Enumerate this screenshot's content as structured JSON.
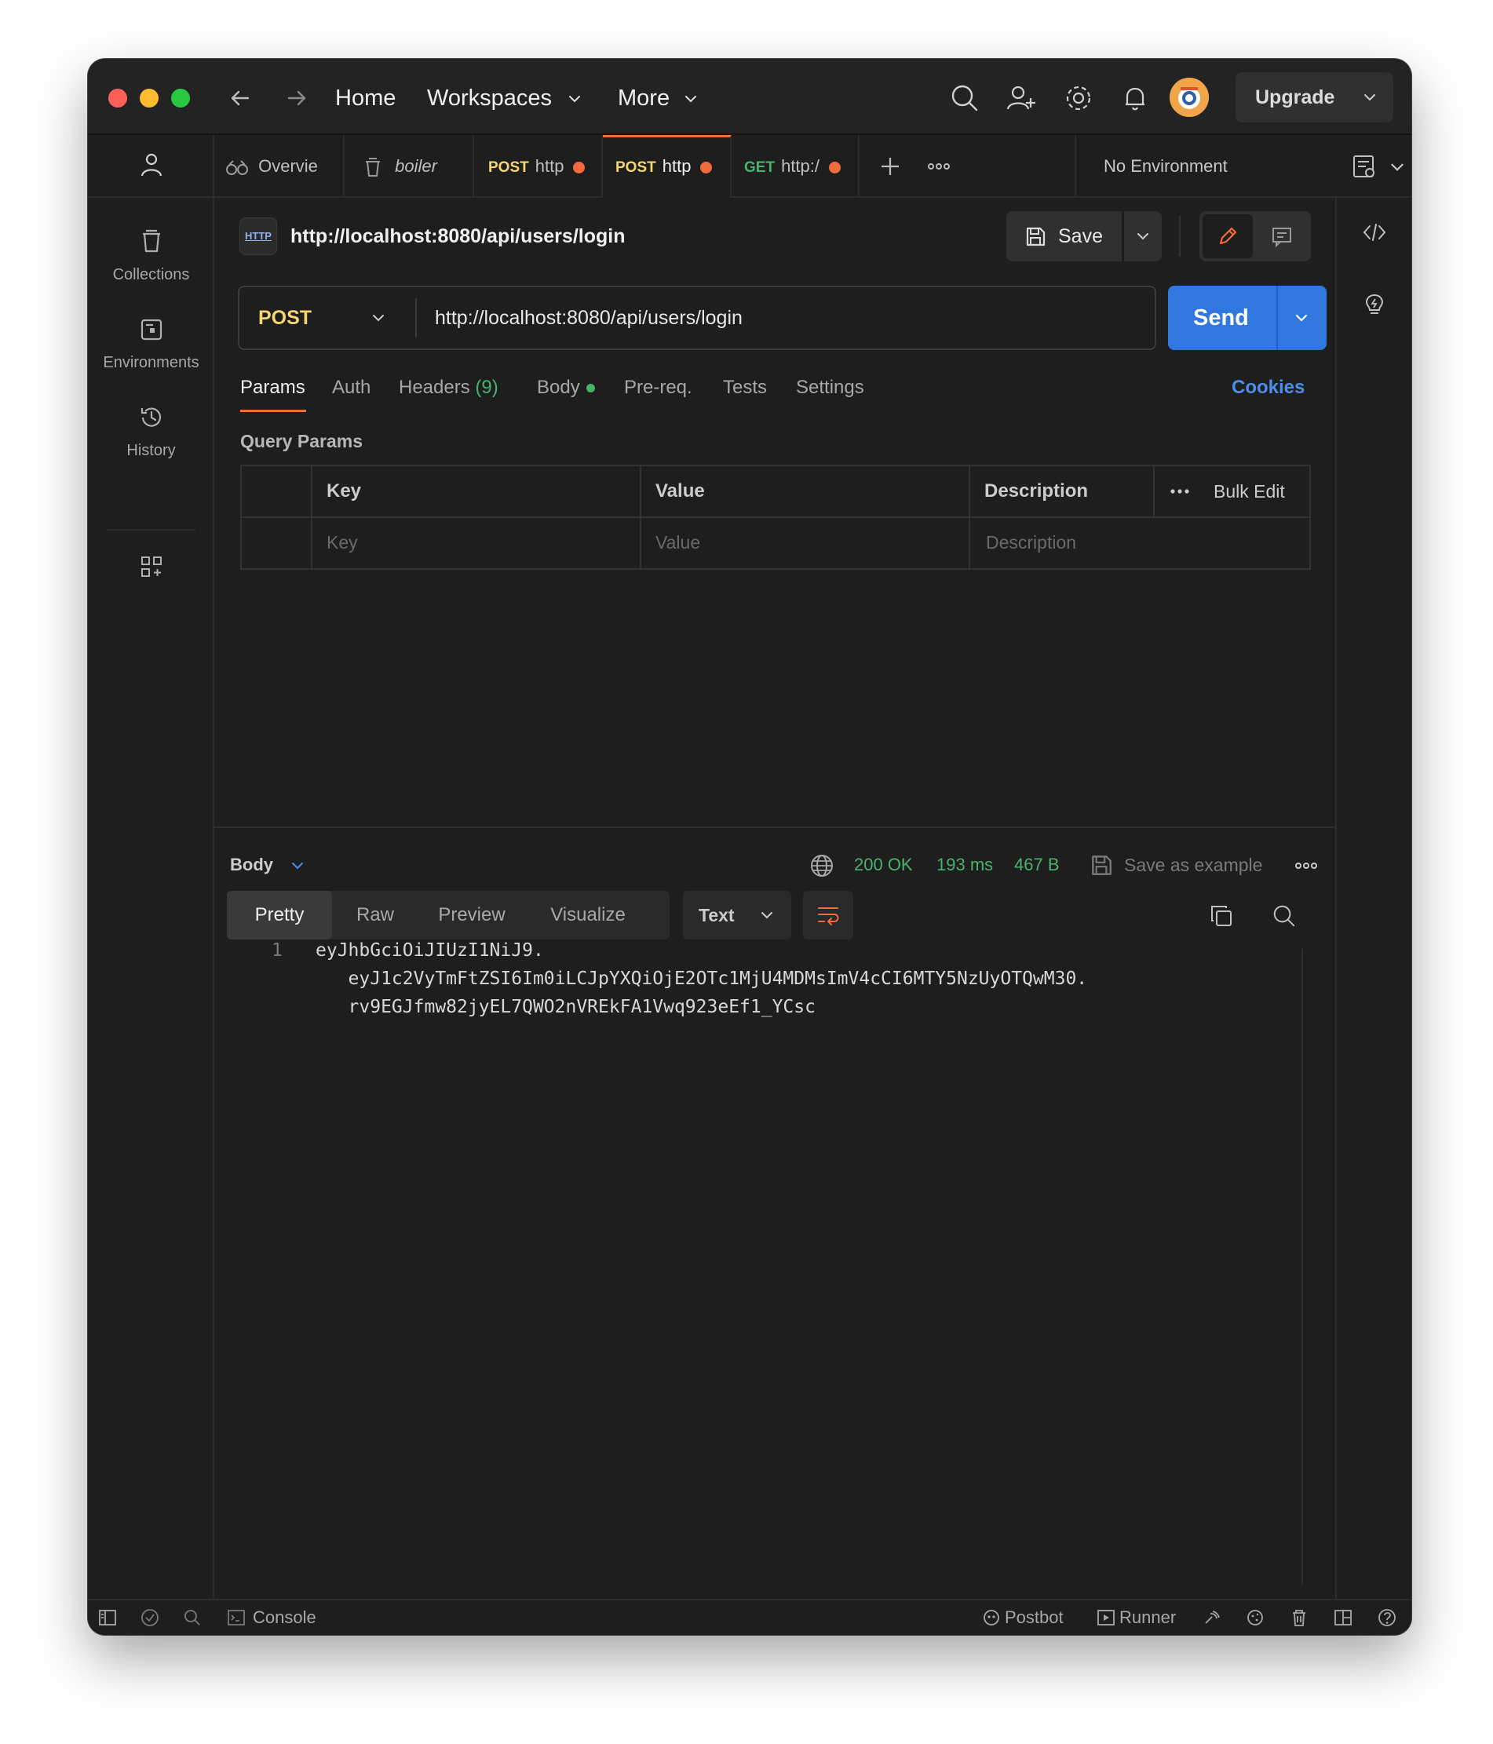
{
  "titlebar": {
    "nav": [
      "Home",
      "Workspaces",
      "More"
    ],
    "upgrade_label": "Upgrade"
  },
  "sidebar": {
    "items": [
      {
        "label": "Collections",
        "icon": "collections-icon"
      },
      {
        "label": "Environments",
        "icon": "environments-icon"
      },
      {
        "label": "History",
        "icon": "history-icon"
      }
    ]
  },
  "tabs": [
    {
      "label": "Overvie",
      "icon": "overview-icon"
    },
    {
      "label": "boiler",
      "icon": "collection-icon"
    },
    {
      "method": "POST",
      "label": "http",
      "unsaved": true
    },
    {
      "method": "POST",
      "label": "http",
      "unsaved": true,
      "active": true
    },
    {
      "method": "GET",
      "label": "http:/",
      "unsaved": true
    }
  ],
  "environment": "No Environment",
  "request": {
    "title": "http://localhost:8080/api/users/login",
    "save_label": "Save",
    "http_badge": "HTTP",
    "method": "POST",
    "url": "http://localhost:8080/api/users/login",
    "send_label": "Send",
    "subtabs": {
      "params": "Params",
      "auth": "Auth",
      "headers": "Headers",
      "headers_count": "(9)",
      "body": "Body",
      "prereq": "Pre-req.",
      "tests": "Tests",
      "settings": "Settings"
    },
    "cookies": "Cookies",
    "query_params_title": "Query Params",
    "table": {
      "headers": [
        "Key",
        "Value",
        "Description"
      ],
      "bulk_edit": "Bulk Edit",
      "placeholders": [
        "Key",
        "Value",
        "Description"
      ]
    }
  },
  "response": {
    "body_label": "Body",
    "status": "200 OK",
    "time": "193 ms",
    "size": "467 B",
    "save_example": "Save as example",
    "views": [
      "Pretty",
      "Raw",
      "Preview",
      "Visualize"
    ],
    "format": "Text",
    "line_number": "1",
    "code_lines": [
      "eyJhbGciOiJIUzI1NiJ9.",
      "   eyJ1c2VyTmFtZSI6Im0iLCJpYXQiOjE2OTc1MjU4MDMsImV4cCI6MTY5NzUyOTQwM30.",
      "   rv9EGJfmw82jyEL7QWO2nVREkFA1Vwq923eEf1_YCsc"
    ]
  },
  "statusbar": {
    "console": "Console",
    "postbot": "Postbot",
    "runner": "Runner"
  },
  "colors": {
    "accent": "#f26b3a",
    "send": "#3077e0",
    "success": "#49b36b",
    "method_post": "#f5d76e",
    "link": "#4a90e8"
  }
}
